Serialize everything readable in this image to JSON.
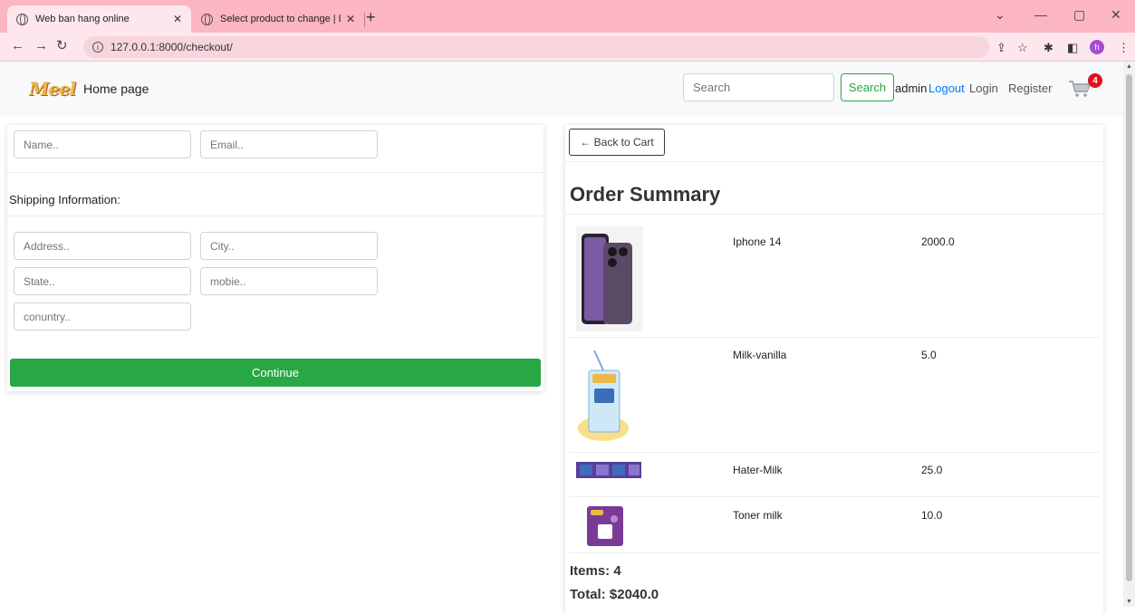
{
  "browser": {
    "tabs": [
      {
        "title": "Web ban hang online",
        "active": true
      },
      {
        "title": "Select product to change | Djang",
        "active": false
      }
    ],
    "url": "127.0.0.1:8000/checkout/",
    "profile_initial": "h"
  },
  "navbar": {
    "logo_text": "Meel",
    "home_label": "Home page",
    "search_placeholder": "Search",
    "search_button": "Search",
    "username": "admin",
    "logout_label": "Logout",
    "login_label": "Login",
    "register_label": "Register",
    "cart_count": "4"
  },
  "form": {
    "name_placeholder": "Name..",
    "email_placeholder": "Email..",
    "shipping_heading": "Shipping Information:",
    "address_placeholder": "Address..",
    "city_placeholder": "City..",
    "state_placeholder": "State..",
    "mobile_placeholder": "mobie..",
    "country_placeholder": "conuntry..",
    "continue_label": "Continue"
  },
  "summary": {
    "back_label": "← Back to Cart",
    "title": "Order Summary",
    "items": [
      {
        "name": "Iphone 14",
        "price": "2000.0"
      },
      {
        "name": "Milk-vanilla",
        "price": "5.0"
      },
      {
        "name": "Hater-Milk",
        "price": "25.0"
      },
      {
        "name": "Toner milk",
        "price": "10.0"
      }
    ],
    "items_line": "Items: 4",
    "total_line": "Total: $2040.0"
  },
  "colors": {
    "accent_green": "#28a745",
    "link_blue": "#007bff",
    "badge_red": "#e0121e",
    "tab_strip": "#fbb5c3"
  }
}
